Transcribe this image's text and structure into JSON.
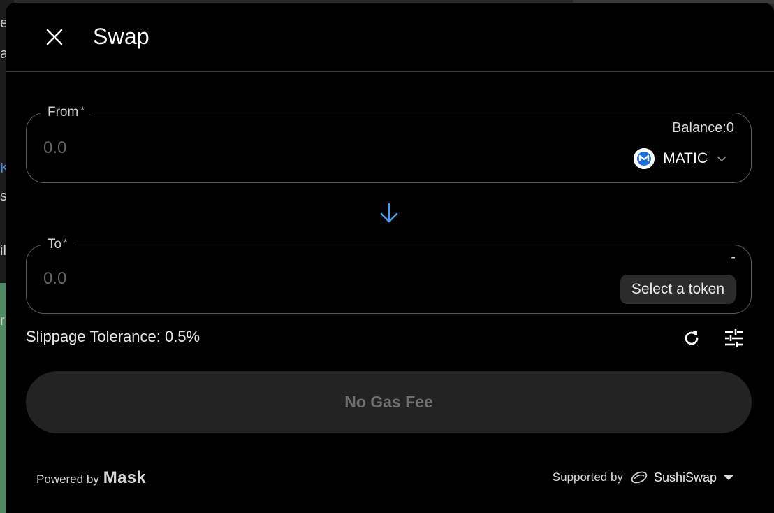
{
  "dialog": {
    "title": "Swap"
  },
  "from": {
    "label": "From",
    "required_mark": "*",
    "amount_placeholder": "0.0",
    "balance_text": "Balance:0",
    "token": "MATIC"
  },
  "to": {
    "label": "To",
    "required_mark": "*",
    "amount_placeholder": "0.0",
    "balance_text": "-",
    "select_token_label": "Select a token"
  },
  "slippage": {
    "text": "Slippage Tolerance: 0.5%"
  },
  "action_button": {
    "label": "No Gas Fee"
  },
  "footer": {
    "powered_by": "Powered by",
    "brand": "Mask",
    "supported_by": "Supported by",
    "provider": "SushiSwap"
  },
  "colors": {
    "accent": "#4a9ee8",
    "dialog_bg": "#000000",
    "button_bg": "#232323"
  },
  "icons": {
    "close": "close-icon",
    "arrow": "arrow-down-icon",
    "refresh": "refresh-icon",
    "settings": "tune-icon",
    "token": "matic-logo-icon",
    "provider": "sushiswap-logo-icon"
  }
}
